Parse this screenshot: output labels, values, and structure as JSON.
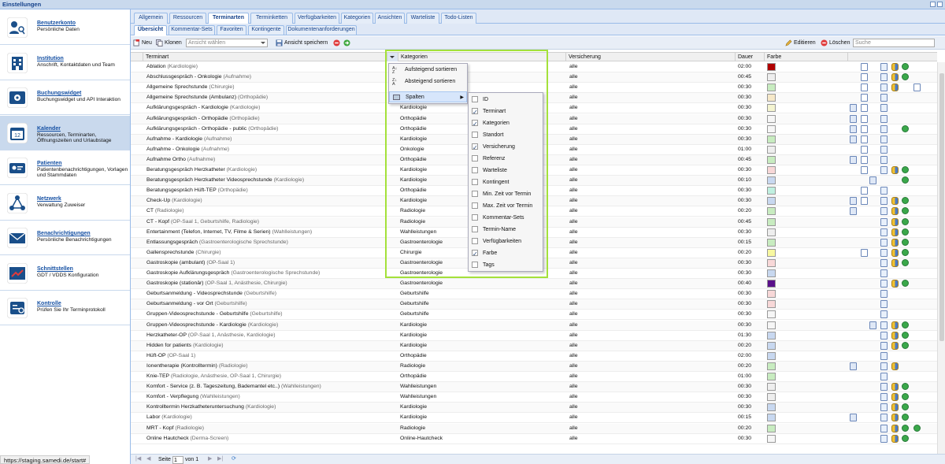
{
  "window": {
    "title": "Einstellungen"
  },
  "sidebar": {
    "items": [
      {
        "title": "Benutzerkonto",
        "desc": "Persönliche Daten",
        "icon": "user-key-icon"
      },
      {
        "title": "Institution",
        "desc": "Anschrift, Kontaktdaten und Team",
        "icon": "building-icon"
      },
      {
        "title": "Buchungswidget",
        "desc": "Buchungswidget und API Interaktion",
        "icon": "widget-gear-icon"
      },
      {
        "title": "Kalender",
        "desc": "Ressourcen, Terminarten, Öffnungszeiten und Urlaubstage",
        "icon": "calendar-icon"
      },
      {
        "title": "Patienten",
        "desc": "Patientenbenachrichtigungen, Vorlagen und Stammdaten",
        "icon": "patient-card-icon"
      },
      {
        "title": "Netzwerk",
        "desc": "Verwaltung Zuweiser",
        "icon": "network-icon"
      },
      {
        "title": "Benachrichtigungen",
        "desc": "Persönliche Benachrichtigungen",
        "icon": "envelope-icon"
      },
      {
        "title": "Schnittstellen",
        "desc": "GDT / VDDS Konfiguration",
        "icon": "interface-icon"
      },
      {
        "title": "Kontrolle",
        "desc": "Prüfen Sie Ihr Terminprotokoll",
        "icon": "protocol-icon"
      }
    ]
  },
  "status_url": "https://staging.samedi.de/start#",
  "tabs": [
    "Allgemein",
    "Ressourcen",
    "Terminarten",
    "Terminketten",
    "Verfügbarkeiten",
    "Kategorien",
    "Ansichten",
    "Warteliste",
    "Todo-Listen"
  ],
  "subtabs": [
    "Übersicht",
    "Kommentar-Sets",
    "Favoriten",
    "Kontingente",
    "Dokumentenanforderungen"
  ],
  "toolbar": {
    "new": "Neu",
    "clone": "Klonen",
    "view_placeholder": "Ansicht wählen",
    "save_view": "Ansicht speichern",
    "edit": "Editieren",
    "delete": "Löschen",
    "search_placeholder": "Suche"
  },
  "columns": {
    "terminart": "Terminart",
    "kategorien": "Kategorien",
    "versicherung": "Versicherung",
    "dauer": "Dauer",
    "farbe": "Farbe"
  },
  "menu": {
    "sort_asc": "Aufsteigend sortieren",
    "sort_desc": "Absteigend sortieren",
    "columns": "Spalten",
    "column_options": [
      {
        "label": "ID",
        "checked": false
      },
      {
        "label": "Terminart",
        "checked": true
      },
      {
        "label": "Kategorien",
        "checked": true
      },
      {
        "label": "Standort",
        "checked": false
      },
      {
        "label": "Versicherung",
        "checked": true
      },
      {
        "label": "Referenz",
        "checked": false
      },
      {
        "label": "Warteliste",
        "checked": false
      },
      {
        "label": "Kontingent",
        "checked": false
      },
      {
        "label": "Min. Zeit vor Termin",
        "checked": false
      },
      {
        "label": "Max. Zeit vor Termin",
        "checked": false
      },
      {
        "label": "Kommentar-Sets",
        "checked": false
      },
      {
        "label": "Termin-Name",
        "checked": false
      },
      {
        "label": "Verfügbarkeiten",
        "checked": false
      },
      {
        "label": "Farbe",
        "checked": true
      },
      {
        "label": "Tags",
        "checked": false
      }
    ]
  },
  "rows": [
    {
      "name": "Ablation",
      "sub": "(Kardiologie)",
      "cat": "",
      "ins": "alle",
      "dur": "02:00",
      "color": "#b00000",
      "icons": [
        "doc",
        "form",
        "people",
        "globe"
      ]
    },
    {
      "name": "Abschlussgespräch - Onkologie",
      "sub": "(Aufnahme)",
      "cat": "",
      "ins": "alle",
      "dur": "00:45",
      "color": "#eeeeee",
      "icons": [
        "doc",
        "form",
        "people",
        "globe"
      ]
    },
    {
      "name": "Allgemeine Sprechstunde",
      "sub": "(Chirurgie)",
      "cat": "",
      "ins": "alle",
      "dur": "00:30",
      "color": "#c8ecc0",
      "icons": [
        "doc",
        "form",
        "people",
        "req"
      ]
    },
    {
      "name": "Allgemeine Sprechstunde (Ambulanz)",
      "sub": "(Orthopädie)",
      "cat": "",
      "ins": "alle",
      "dur": "00:30",
      "color": "#f6e8c8",
      "icons": [
        "doc",
        "form"
      ]
    },
    {
      "name": "Aufklärungsgespräch - Kardiologie",
      "sub": "(Kardiologie)",
      "cat": "Kardiologie",
      "ins": "alle",
      "dur": "00:30",
      "color": "#f4f4d0",
      "icons": [
        "cal",
        "doc",
        "form"
      ]
    },
    {
      "name": "Aufklärungsgespräch - Orthopädie",
      "sub": "(Orthopädie)",
      "cat": "Orthopädie",
      "ins": "alle",
      "dur": "00:30",
      "color": "#f6f6f6",
      "icons": [
        "cal",
        "doc",
        "form"
      ]
    },
    {
      "name": "Aufklärungsgespräch - Orthopädie - public",
      "sub": "(Orthopädie)",
      "cat": "Orthopädie",
      "ins": "alle",
      "dur": "00:30",
      "color": "#f6f6f6",
      "icons": [
        "cal",
        "doc",
        "form",
        "globe"
      ]
    },
    {
      "name": "Aufnahme - Kardiologie",
      "sub": "(Aufnahme)",
      "cat": "Kardiologie",
      "ins": "alle",
      "dur": "00:30",
      "color": "#c8ecc0",
      "icons": [
        "cal",
        "doc",
        "form"
      ]
    },
    {
      "name": "Aufnahme - Onkologie",
      "sub": "(Aufnahme)",
      "cat": "Onkologie",
      "ins": "alle",
      "dur": "01:00",
      "color": "#eeeeee",
      "icons": [
        "doc",
        "form"
      ]
    },
    {
      "name": "Aufnahme Ortho",
      "sub": "(Aufnahme)",
      "cat": "Orthopädie",
      "ins": "alle",
      "dur": "00:45",
      "color": "#c8ecc0",
      "icons": [
        "cal",
        "doc",
        "form"
      ]
    },
    {
      "name": "Beratungsgespräch Herzkatheter",
      "sub": "(Kardiologie)",
      "cat": "Kardiologie",
      "ins": "alle",
      "dur": "00:30",
      "color": "#f8d8d8",
      "icons": [
        "doc",
        "form",
        "people",
        "globe"
      ]
    },
    {
      "name": "Beratungsgespräch Herzkatheter Videosprechstunde",
      "sub": "(Kardiologie)",
      "cat": "Kardiologie",
      "ins": "alle",
      "dur": "00:10",
      "color": "#c8d8f0",
      "icons": [
        "video",
        "globe"
      ]
    },
    {
      "name": "Beratungsgespräch Hüft-TEP",
      "sub": "(Orthopädie)",
      "cat": "Orthopädie",
      "ins": "alle",
      "dur": "00:30",
      "color": "#c0f0e0",
      "icons": [
        "doc",
        "form"
      ]
    },
    {
      "name": "Check-Up",
      "sub": "(Kardiologie)",
      "cat": "Kardiologie",
      "ins": "alle",
      "dur": "00:30",
      "color": "#c8d8f0",
      "icons": [
        "doc",
        "form",
        "people",
        "globe",
        "cal"
      ]
    },
    {
      "name": "CT",
      "sub": "(Radiologie)",
      "cat": "Radiologie",
      "ins": "alle",
      "dur": "00:20",
      "color": "#c8ecc0",
      "icons": [
        "cal",
        "form",
        "people",
        "globe"
      ]
    },
    {
      "name": "CT - Kopf",
      "sub": "(OP-Saal 1, Geburtshilfe, Radiologie)",
      "cat": "Radiologie",
      "ins": "alle",
      "dur": "00:45",
      "color": "#c8ecc0",
      "icons": [
        "form",
        "people",
        "globe"
      ]
    },
    {
      "name": "Entertainment (Telefon, Internet, TV, Filme & Serien)",
      "sub": "(Wahlleistungen)",
      "cat": "Wahlleistungen",
      "ins": "alle",
      "dur": "00:30",
      "color": "#eeeeee",
      "icons": [
        "form",
        "people",
        "globe"
      ]
    },
    {
      "name": "Entlassungsgespräch",
      "sub": "(Gastroenterologische Sprechstunde)",
      "cat": "Gastroenterologie",
      "ins": "alle",
      "dur": "00:15",
      "color": "#c8ecc0",
      "icons": [
        "form",
        "people",
        "globe"
      ]
    },
    {
      "name": "Gallensprechstunde",
      "sub": "(Chirurgie)",
      "cat": "Chirurgie",
      "ins": "alle",
      "dur": "00:20",
      "color": "#f8f8a0",
      "icons": [
        "doc",
        "form",
        "people",
        "globe"
      ]
    },
    {
      "name": "Gastroskopie (ambulant)",
      "sub": "(OP-Saal 1)",
      "cat": "Gastroenterologie",
      "ins": "alle",
      "dur": "00:30",
      "color": "#f8d8d8",
      "icons": [
        "form",
        "people",
        "globe"
      ]
    },
    {
      "name": "Gastroskopie Aufklärungsgespräch",
      "sub": "(Gastroenterologische Sprechstunde)",
      "cat": "Gastroenterologie",
      "ins": "alle",
      "dur": "00:30",
      "color": "#c8d8f0",
      "icons": [
        "form"
      ]
    },
    {
      "name": "Gastroskopie (stationär)",
      "sub": "(OP-Saal 1, Anästhesie, Chirurgie)",
      "cat": "Gastroenterologie",
      "ins": "alle",
      "dur": "00:40",
      "color": "#5a108a",
      "icons": [
        "form",
        "people",
        "globe"
      ]
    },
    {
      "name": "Geburtsanmeldung - Videosprechstunde",
      "sub": "(Geburtshilfe)",
      "cat": "Geburtshilfe",
      "ins": "alle",
      "dur": "00:30",
      "color": "#f8d8d8",
      "icons": [
        "form"
      ]
    },
    {
      "name": "Geburtsanmeldung - vor Ort",
      "sub": "(Geburtshilfe)",
      "cat": "Geburtshilfe",
      "ins": "alle",
      "dur": "00:30",
      "color": "#f8d8d8",
      "icons": [
        "form"
      ]
    },
    {
      "name": "Gruppen-Videosprechstunde - Geburtshilfe",
      "sub": "(Geburtshilfe)",
      "cat": "Geburtshilfe",
      "ins": "alle",
      "dur": "00:30",
      "color": "#f6f6f6",
      "icons": [
        "form"
      ]
    },
    {
      "name": "Gruppen-Videosprechstunde - Kardiologie",
      "sub": "(Kardiologie)",
      "cat": "Kardiologie",
      "ins": "alle",
      "dur": "00:30",
      "color": "#f6f6f6",
      "icons": [
        "video",
        "form",
        "people",
        "globe"
      ]
    },
    {
      "name": "Herzkatheter-OP",
      "sub": "(OP-Saal 1, Anästhesie, Kardiologie)",
      "cat": "Kardiologie",
      "ins": "alle",
      "dur": "01:30",
      "color": "#c8d8f0",
      "icons": [
        "form",
        "people",
        "globe"
      ]
    },
    {
      "name": "Hidden for patients",
      "sub": "(Kardiologie)",
      "cat": "Kardiologie",
      "ins": "alle",
      "dur": "00:20",
      "color": "#c8d8f0",
      "icons": [
        "form",
        "people",
        "globe"
      ]
    },
    {
      "name": "Hüft-OP",
      "sub": "(OP-Saal 1)",
      "cat": "Orthopädie",
      "ins": "alle",
      "dur": "02:00",
      "color": "#c8d8f0",
      "icons": [
        "form"
      ]
    },
    {
      "name": "Ionentherapie (Kontrolltermin)",
      "sub": "(Radiologie)",
      "cat": "Radiologie",
      "ins": "alle",
      "dur": "00:20",
      "color": "#c8ecc0",
      "icons": [
        "cal",
        "form",
        "people"
      ]
    },
    {
      "name": "Knie-TEP",
      "sub": "(Radiologie, Anästhesie, OP-Saal 1, Chirurgie)",
      "cat": "Orthopädie",
      "ins": "alle",
      "dur": "01:00",
      "color": "#c8ecc0",
      "icons": [
        "form"
      ]
    },
    {
      "name": "Komfort - Service (z. B. Tageszeitung, Bademantel etc..)",
      "sub": "(Wahlleistungen)",
      "cat": "Wahlleistungen",
      "ins": "alle",
      "dur": "00:30",
      "color": "#eeeeee",
      "icons": [
        "form",
        "people",
        "globe"
      ]
    },
    {
      "name": "Komfort - Verpflegung",
      "sub": "(Wahlleistungen)",
      "cat": "Wahlleistungen",
      "ins": "alle",
      "dur": "00:30",
      "color": "#eeeeee",
      "icons": [
        "form",
        "people",
        "globe"
      ]
    },
    {
      "name": "Kontrolltermin Herzkatheteruntersuchung",
      "sub": "(Kardiologie)",
      "cat": "Kardiologie",
      "ins": "alle",
      "dur": "00:30",
      "color": "#c8d8f0",
      "icons": [
        "form",
        "people",
        "globe"
      ]
    },
    {
      "name": "Labor",
      "sub": "(Kardiologie)",
      "cat": "Kardiologie",
      "ins": "alle",
      "dur": "00:15",
      "color": "#c8d8f0",
      "icons": [
        "cal",
        "form",
        "people",
        "globe"
      ]
    },
    {
      "name": "MRT - Kopf",
      "sub": "(Radiologie)",
      "cat": "Radiologie",
      "ins": "alle",
      "dur": "00:20",
      "color": "#c8ecc0",
      "icons": [
        "form",
        "people",
        "globe",
        "globe"
      ]
    },
    {
      "name": "Online Hautcheck",
      "sub": "(Derma-Screen)",
      "cat": "Online-Hautcheck",
      "ins": "alle",
      "dur": "00:30",
      "color": "#f6f6f6",
      "icons": [
        "form",
        "people",
        "globe"
      ]
    }
  ],
  "pager": {
    "page_label": "Seite",
    "page": "1",
    "of_label": "von 1"
  }
}
